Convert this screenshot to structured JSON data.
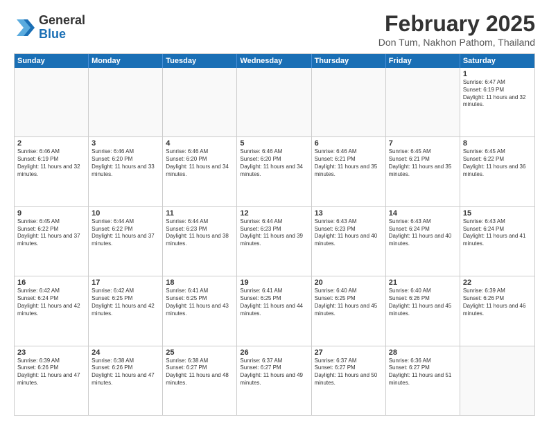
{
  "logo": {
    "general": "General",
    "blue": "Blue"
  },
  "title": "February 2025",
  "subtitle": "Don Tum, Nakhon Pathom, Thailand",
  "header": {
    "days": [
      "Sunday",
      "Monday",
      "Tuesday",
      "Wednesday",
      "Thursday",
      "Friday",
      "Saturday"
    ]
  },
  "weeks": [
    [
      {
        "day": "",
        "empty": true
      },
      {
        "day": "",
        "empty": true
      },
      {
        "day": "",
        "empty": true
      },
      {
        "day": "",
        "empty": true
      },
      {
        "day": "",
        "empty": true
      },
      {
        "day": "",
        "empty": true
      },
      {
        "day": "1",
        "sunrise": "Sunrise: 6:47 AM",
        "sunset": "Sunset: 6:19 PM",
        "daylight": "Daylight: 11 hours and 32 minutes."
      }
    ],
    [
      {
        "day": "2",
        "sunrise": "Sunrise: 6:46 AM",
        "sunset": "Sunset: 6:19 PM",
        "daylight": "Daylight: 11 hours and 32 minutes."
      },
      {
        "day": "3",
        "sunrise": "Sunrise: 6:46 AM",
        "sunset": "Sunset: 6:20 PM",
        "daylight": "Daylight: 11 hours and 33 minutes."
      },
      {
        "day": "4",
        "sunrise": "Sunrise: 6:46 AM",
        "sunset": "Sunset: 6:20 PM",
        "daylight": "Daylight: 11 hours and 34 minutes."
      },
      {
        "day": "5",
        "sunrise": "Sunrise: 6:46 AM",
        "sunset": "Sunset: 6:20 PM",
        "daylight": "Daylight: 11 hours and 34 minutes."
      },
      {
        "day": "6",
        "sunrise": "Sunrise: 6:46 AM",
        "sunset": "Sunset: 6:21 PM",
        "daylight": "Daylight: 11 hours and 35 minutes."
      },
      {
        "day": "7",
        "sunrise": "Sunrise: 6:45 AM",
        "sunset": "Sunset: 6:21 PM",
        "daylight": "Daylight: 11 hours and 35 minutes."
      },
      {
        "day": "8",
        "sunrise": "Sunrise: 6:45 AM",
        "sunset": "Sunset: 6:22 PM",
        "daylight": "Daylight: 11 hours and 36 minutes."
      }
    ],
    [
      {
        "day": "9",
        "sunrise": "Sunrise: 6:45 AM",
        "sunset": "Sunset: 6:22 PM",
        "daylight": "Daylight: 11 hours and 37 minutes."
      },
      {
        "day": "10",
        "sunrise": "Sunrise: 6:44 AM",
        "sunset": "Sunset: 6:22 PM",
        "daylight": "Daylight: 11 hours and 37 minutes."
      },
      {
        "day": "11",
        "sunrise": "Sunrise: 6:44 AM",
        "sunset": "Sunset: 6:23 PM",
        "daylight": "Daylight: 11 hours and 38 minutes."
      },
      {
        "day": "12",
        "sunrise": "Sunrise: 6:44 AM",
        "sunset": "Sunset: 6:23 PM",
        "daylight": "Daylight: 11 hours and 39 minutes."
      },
      {
        "day": "13",
        "sunrise": "Sunrise: 6:43 AM",
        "sunset": "Sunset: 6:23 PM",
        "daylight": "Daylight: 11 hours and 40 minutes."
      },
      {
        "day": "14",
        "sunrise": "Sunrise: 6:43 AM",
        "sunset": "Sunset: 6:24 PM",
        "daylight": "Daylight: 11 hours and 40 minutes."
      },
      {
        "day": "15",
        "sunrise": "Sunrise: 6:43 AM",
        "sunset": "Sunset: 6:24 PM",
        "daylight": "Daylight: 11 hours and 41 minutes."
      }
    ],
    [
      {
        "day": "16",
        "sunrise": "Sunrise: 6:42 AM",
        "sunset": "Sunset: 6:24 PM",
        "daylight": "Daylight: 11 hours and 42 minutes."
      },
      {
        "day": "17",
        "sunrise": "Sunrise: 6:42 AM",
        "sunset": "Sunset: 6:25 PM",
        "daylight": "Daylight: 11 hours and 42 minutes."
      },
      {
        "day": "18",
        "sunrise": "Sunrise: 6:41 AM",
        "sunset": "Sunset: 6:25 PM",
        "daylight": "Daylight: 11 hours and 43 minutes."
      },
      {
        "day": "19",
        "sunrise": "Sunrise: 6:41 AM",
        "sunset": "Sunset: 6:25 PM",
        "daylight": "Daylight: 11 hours and 44 minutes."
      },
      {
        "day": "20",
        "sunrise": "Sunrise: 6:40 AM",
        "sunset": "Sunset: 6:25 PM",
        "daylight": "Daylight: 11 hours and 45 minutes."
      },
      {
        "day": "21",
        "sunrise": "Sunrise: 6:40 AM",
        "sunset": "Sunset: 6:26 PM",
        "daylight": "Daylight: 11 hours and 45 minutes."
      },
      {
        "day": "22",
        "sunrise": "Sunrise: 6:39 AM",
        "sunset": "Sunset: 6:26 PM",
        "daylight": "Daylight: 11 hours and 46 minutes."
      }
    ],
    [
      {
        "day": "23",
        "sunrise": "Sunrise: 6:39 AM",
        "sunset": "Sunset: 6:26 PM",
        "daylight": "Daylight: 11 hours and 47 minutes."
      },
      {
        "day": "24",
        "sunrise": "Sunrise: 6:38 AM",
        "sunset": "Sunset: 6:26 PM",
        "daylight": "Daylight: 11 hours and 47 minutes."
      },
      {
        "day": "25",
        "sunrise": "Sunrise: 6:38 AM",
        "sunset": "Sunset: 6:27 PM",
        "daylight": "Daylight: 11 hours and 48 minutes."
      },
      {
        "day": "26",
        "sunrise": "Sunrise: 6:37 AM",
        "sunset": "Sunset: 6:27 PM",
        "daylight": "Daylight: 11 hours and 49 minutes."
      },
      {
        "day": "27",
        "sunrise": "Sunrise: 6:37 AM",
        "sunset": "Sunset: 6:27 PM",
        "daylight": "Daylight: 11 hours and 50 minutes."
      },
      {
        "day": "28",
        "sunrise": "Sunrise: 6:36 AM",
        "sunset": "Sunset: 6:27 PM",
        "daylight": "Daylight: 11 hours and 51 minutes."
      },
      {
        "day": "",
        "empty": true
      }
    ]
  ]
}
